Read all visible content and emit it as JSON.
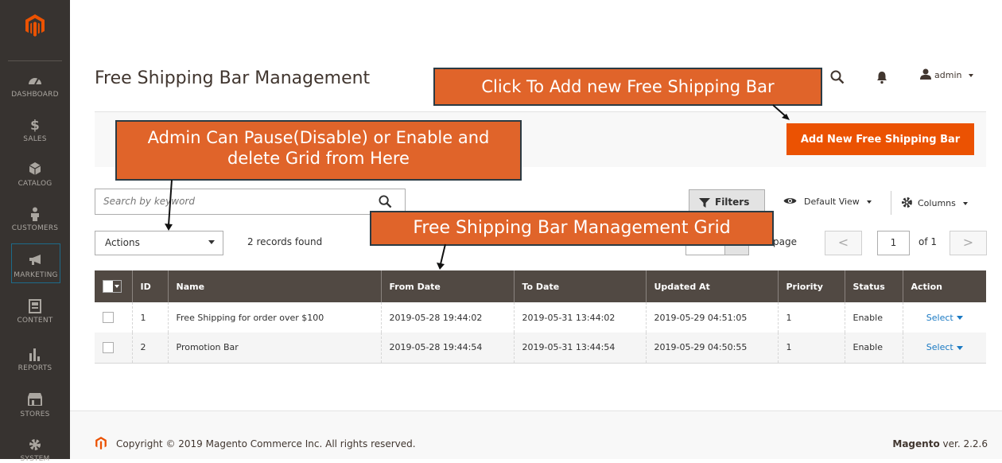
{
  "sidebar": {
    "items": [
      {
        "label": "DASHBOARD",
        "icon": "dashboard-icon"
      },
      {
        "label": "SALES",
        "icon": "dollar-icon"
      },
      {
        "label": "CATALOG",
        "icon": "box-icon"
      },
      {
        "label": "CUSTOMERS",
        "icon": "person-icon"
      },
      {
        "label": "MARKETING",
        "icon": "megaphone-icon"
      },
      {
        "label": "CONTENT",
        "icon": "content-icon"
      },
      {
        "label": "REPORTS",
        "icon": "bar-chart-icon"
      },
      {
        "label": "STORES",
        "icon": "store-icon"
      },
      {
        "label": "SYSTEM",
        "icon": "gear-icon"
      }
    ]
  },
  "header": {
    "title": "Free Shipping Bar Management",
    "user": "admin"
  },
  "toolbar": {
    "add_label": "Add New Free Shipping Bar"
  },
  "search": {
    "placeholder": "Search by keyword"
  },
  "grid_controls": {
    "filters_label": "Filters",
    "default_view_label": "Default View",
    "columns_label": "Columns",
    "actions_label": "Actions",
    "records_found": "2 records found",
    "per_page_label": "page",
    "current_page": "1",
    "of_pages": "of 1",
    "prev_symbol": "<",
    "next_symbol": ">"
  },
  "grid": {
    "columns": [
      "ID",
      "Name",
      "From Date",
      "To Date",
      "Updated At",
      "Priority",
      "Status",
      "Action"
    ],
    "rows": [
      {
        "id": "1",
        "name": "Free Shipping for order over $100",
        "from": "2019-05-28 19:44:02",
        "to": "2019-05-31 13:44:02",
        "updated": "2019-05-29 04:51:05",
        "priority": "1",
        "status": "Enable",
        "action": "Select"
      },
      {
        "id": "2",
        "name": "Promotion Bar",
        "from": "2019-05-28 19:44:54",
        "to": "2019-05-31 13:44:54",
        "updated": "2019-05-29 04:50:55",
        "priority": "1",
        "status": "Enable",
        "action": "Select"
      }
    ]
  },
  "footer": {
    "copyright": "Copyright © 2019 Magento Commerce Inc. All rights reserved.",
    "brand": "Magento",
    "version": "ver. 2.2.6"
  },
  "callouts": {
    "add_new": "Click To Add new Free Shipping Bar",
    "pause": "Admin Can Pause(Disable) or Enable and  delete Grid from Here",
    "grid": "Free Shipping Bar Management Grid"
  },
  "colors": {
    "accent": "#eb5202",
    "sidebar": "#373330",
    "grid_header": "#514943",
    "link": "#1979c3",
    "callout": "#e0642a"
  }
}
